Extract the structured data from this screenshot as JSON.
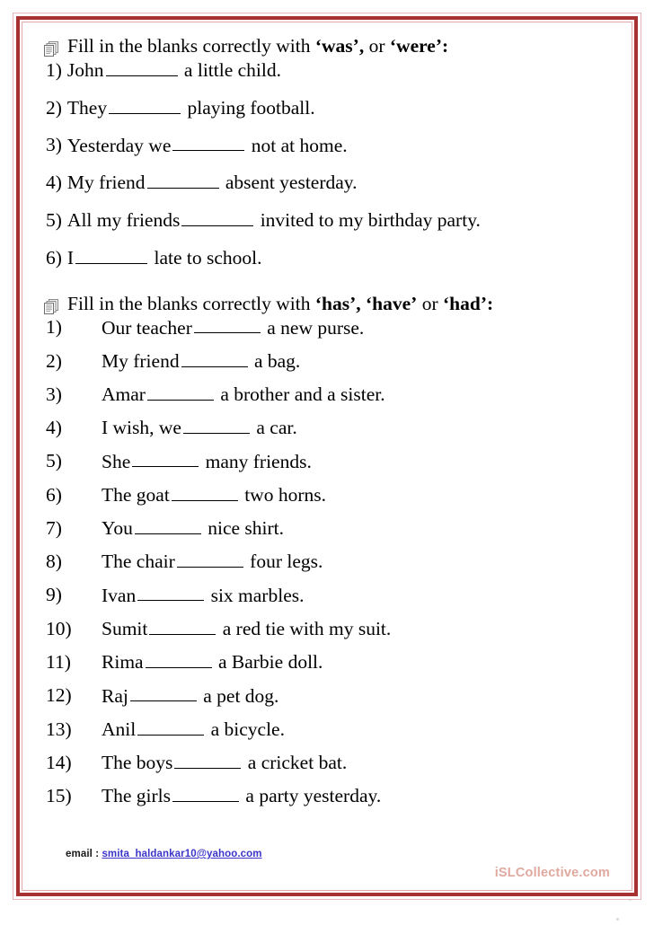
{
  "page": {
    "background_color": "#ffffff",
    "frame_outer_color": "#e6b9b9",
    "frame_mid_color": "#a83232",
    "frame_inner_color": "#e0a8a8"
  },
  "sections": [
    {
      "id": "was-were",
      "icon": "stacked-documents-icon",
      "heading": {
        "lead": "Fill in the blanks correctly with ",
        "word1": "‘was’,",
        "between": " or ",
        "word2": "‘were’:"
      },
      "items": [
        {
          "num": "1)",
          "before": "John",
          "after": "a little child."
        },
        {
          "num": "2)",
          "before": "They",
          "after": "playing football."
        },
        {
          "num": "3)",
          "before": "Yesterday we",
          "after": "not at home."
        },
        {
          "num": "4)",
          "before": "My friend",
          "after": "absent yesterday."
        },
        {
          "num": "5)",
          "before": "All my friends",
          "after": "invited to my birthday party."
        },
        {
          "num": "6)",
          "before": "I",
          "after": "late to school."
        }
      ]
    },
    {
      "id": "has-have-had",
      "icon": "stacked-documents-icon",
      "heading": {
        "lead": "Fill in the blanks correctly with ",
        "word1": "‘has’, ‘have’",
        "between": " or ",
        "word2": "‘had’:"
      },
      "items": [
        {
          "num": "1)",
          "before": "Our teacher",
          "after": "a new purse."
        },
        {
          "num": "2)",
          "before": "My friend",
          "after": "a bag."
        },
        {
          "num": "3)",
          "before": "Amar",
          "after": "a brother and a sister."
        },
        {
          "num": "4)",
          "before": "I wish, we",
          "after": "a car."
        },
        {
          "num": "5)",
          "before": "She",
          "after": "many friends."
        },
        {
          "num": "6)",
          "before": "The goat",
          "after": "two horns."
        },
        {
          "num": "7)",
          "before": "You",
          "after": "nice shirt."
        },
        {
          "num": "8)",
          "before": "The chair",
          "after": "four legs."
        },
        {
          "num": "9)",
          "before": "Ivan",
          "after": "six marbles."
        },
        {
          "num": "10)",
          "before": "Sumit",
          "after": "a red tie with my suit."
        },
        {
          "num": "11)",
          "before": "Rima",
          "after": "a Barbie doll."
        },
        {
          "num": "12)",
          "before": "Raj",
          "after": "a pet dog."
        },
        {
          "num": "13)",
          "before": "Anil",
          "after": "a bicycle."
        },
        {
          "num": "14)",
          "before": "The boys",
          "after": "a cricket bat."
        },
        {
          "num": "15)",
          "before": "The girls",
          "after": "a party yesterday."
        }
      ]
    }
  ],
  "footer": {
    "email_label": "email : ",
    "email_address": "smita_haldankar10@yahoo.com",
    "email_link_color": "#3b35c9",
    "watermark": "iSLCollective.com",
    "watermark_color": "#e0a9a0"
  }
}
